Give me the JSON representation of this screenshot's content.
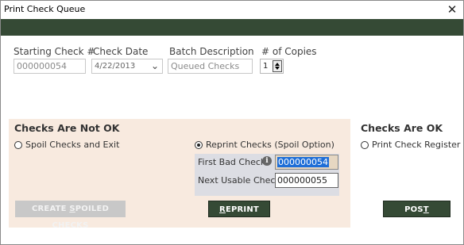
{
  "window": {
    "title": "Print Check Queue",
    "close_glyph": "✕"
  },
  "fields": {
    "starting_check": {
      "label": "Starting Check #",
      "value": "000000054"
    },
    "check_date": {
      "label": "Check Date",
      "value": "4/22/2013"
    },
    "batch_description": {
      "label": "Batch Description",
      "value": "Queued Checks"
    },
    "copies": {
      "label": "# of Copies",
      "value": "1"
    }
  },
  "not_ok": {
    "title": "Checks Are Not OK",
    "spoil_option": "Spoil Checks and Exit",
    "reprint_option": "Reprint Checks (Spoil Option)",
    "first_bad_label": "First Bad Check:",
    "first_bad_value": "000000054",
    "next_usable_label": "Next Usable Check:",
    "next_usable_value": "000000055",
    "create_spoiled_pre": "CREATE ",
    "create_spoiled_key": "S",
    "create_spoiled_post": "POILED CHECKS",
    "reprint_key": "R",
    "reprint_post": "EPRINT"
  },
  "ok": {
    "title": "Checks Are OK",
    "print_register_option": "Print Check Register",
    "post_pre": "POS",
    "post_key": "T"
  },
  "colors": {
    "accent": "#354a35",
    "panel_bg": "#f8eadf",
    "selection": "#1e6ed7"
  }
}
